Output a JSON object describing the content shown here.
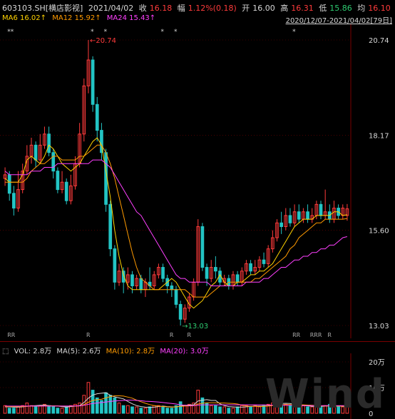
{
  "header": {
    "code": "603103.SH[横店影视]",
    "date": "2021/04/02",
    "close_label": "收",
    "close_value": "16.18",
    "change_label": "幅",
    "change_value": "1.12%(0.18)",
    "open_label": "开",
    "open_value": "16.00",
    "high_label": "高",
    "high_value": "16.31",
    "low_label": "低",
    "low_value": "15.86",
    "avg_label": "均",
    "avg_value": "16.10",
    "ma6": "MA6 16.02↑",
    "ma12": "MA12 15.92↑",
    "ma24": "MA24 15.43↑",
    "range": "2020/12/07-2021/04/02[79日]"
  },
  "volume_header": {
    "vol": "VOL: 2.8万",
    "ma5": "MA(5): 2.6万",
    "ma10": "MA(10): 2.8万",
    "ma20": "MA(20): 3.0万"
  },
  "colors": {
    "up": "#ff3b3b",
    "down": "#23c4c4",
    "ma6": "#ffd200",
    "ma12": "#ff9a00",
    "ma24": "#ff40ff",
    "grid": "#7a0000"
  },
  "annotations": {
    "high": "20.74",
    "low": "13.03",
    "watermark": "Wind"
  },
  "chart_data": {
    "type": "candlestick",
    "price_ticks": [
      "20.74",
      "18.17",
      "15.60",
      "13.03"
    ],
    "price_range": [
      13.03,
      20.74
    ],
    "volume_ticks": [
      "20万",
      "10万",
      "0"
    ],
    "volume_range": [
      0,
      20
    ],
    "markers_top": [
      "**",
      "*",
      "*",
      "*",
      "*",
      "*"
    ],
    "markers_bottom": [
      "RR",
      "R",
      "R",
      "R",
      "RR",
      "RRR",
      "R"
    ],
    "series": [
      {
        "name": "MA6",
        "values": [
          17.0,
          16.9,
          16.9,
          16.9,
          17.1,
          17.5,
          17.6,
          17.5,
          17.4,
          17.6,
          17.9,
          17.8,
          17.6,
          17.4,
          17.3,
          17.2,
          17.3,
          17.4,
          17.6,
          17.8,
          18.0,
          18.1,
          17.9,
          17.2,
          16.5,
          15.6,
          14.9,
          14.4,
          14.1,
          14.0,
          14.0,
          14.0,
          14.0,
          14.0,
          14.0,
          14.0,
          14.1,
          14.2,
          14.3,
          14.2,
          14.0,
          13.8,
          13.6,
          13.5,
          13.6,
          13.7,
          13.9,
          14.1,
          14.2,
          14.4,
          14.2,
          14.1,
          14.1,
          14.2,
          14.2,
          14.3,
          14.4,
          14.4,
          14.5,
          14.5,
          14.6,
          14.7,
          14.9,
          15.1,
          15.3,
          15.5,
          15.7,
          15.8,
          15.9,
          15.9,
          15.9,
          16.0,
          16.0,
          16.0,
          16.0,
          16.1,
          16.1,
          16.0,
          16.02
        ]
      },
      {
        "name": "MA12",
        "values": [
          16.9,
          16.9,
          16.9,
          16.9,
          16.9,
          17.0,
          17.2,
          17.3,
          17.4,
          17.4,
          17.5,
          17.6,
          17.6,
          17.5,
          17.5,
          17.5,
          17.5,
          17.6,
          17.6,
          17.7,
          17.8,
          17.9,
          17.9,
          17.7,
          17.4,
          17.0,
          16.5,
          16.0,
          15.5,
          15.0,
          14.6,
          14.3,
          14.2,
          14.1,
          14.0,
          14.0,
          14.0,
          14.0,
          14.0,
          14.0,
          14.0,
          14.0,
          13.9,
          13.8,
          13.8,
          13.8,
          13.8,
          13.9,
          14.0,
          14.1,
          14.1,
          14.2,
          14.2,
          14.2,
          14.2,
          14.2,
          14.2,
          14.3,
          14.3,
          14.4,
          14.5,
          14.6,
          14.7,
          14.8,
          14.9,
          15.1,
          15.2,
          15.4,
          15.5,
          15.6,
          15.7,
          15.8,
          15.8,
          15.9,
          15.9,
          15.9,
          15.9,
          15.9,
          15.92
        ]
      },
      {
        "name": "MA24",
        "values": [
          17.2,
          17.1,
          17.1,
          17.1,
          17.1,
          17.1,
          17.2,
          17.2,
          17.2,
          17.3,
          17.3,
          17.3,
          17.4,
          17.4,
          17.4,
          17.4,
          17.4,
          17.4,
          17.4,
          17.4,
          17.5,
          17.5,
          17.5,
          17.4,
          17.3,
          17.1,
          16.9,
          16.7,
          16.5,
          16.3,
          16.1,
          16.0,
          15.8,
          15.6,
          15.4,
          15.2,
          15.0,
          14.8,
          14.6,
          14.4,
          14.3,
          14.3,
          14.2,
          14.2,
          14.2,
          14.2,
          14.2,
          14.1,
          14.1,
          14.1,
          14.1,
          14.1,
          14.1,
          14.1,
          14.1,
          14.2,
          14.2,
          14.2,
          14.2,
          14.3,
          14.3,
          14.4,
          14.5,
          14.6,
          14.6,
          14.7,
          14.8,
          14.8,
          14.9,
          14.9,
          15.0,
          15.0,
          15.1,
          15.1,
          15.2,
          15.2,
          15.3,
          15.4,
          15.43
        ]
      }
    ],
    "candles": [
      [
        17.0,
        17.1,
        16.8,
        17.3
      ],
      [
        17.1,
        16.6,
        16.4,
        17.2
      ],
      [
        16.6,
        16.2,
        16.0,
        16.8
      ],
      [
        16.2,
        16.7,
        16.1,
        17.2
      ],
      [
        16.7,
        17.2,
        16.6,
        17.4
      ],
      [
        17.2,
        17.6,
        17.1,
        17.9
      ],
      [
        17.6,
        17.9,
        17.4,
        18.1
      ],
      [
        17.9,
        17.5,
        17.3,
        18.0
      ],
      [
        17.5,
        17.9,
        17.4,
        18.2
      ],
      [
        17.9,
        18.2,
        17.8,
        18.4
      ],
      [
        18.2,
        17.7,
        17.6,
        18.4
      ],
      [
        17.7,
        17.2,
        17.0,
        17.8
      ],
      [
        17.2,
        16.7,
        16.6,
        17.3
      ],
      [
        16.7,
        16.9,
        16.6,
        17.2
      ],
      [
        16.9,
        16.4,
        16.3,
        17.0
      ],
      [
        16.4,
        16.8,
        16.3,
        17.1
      ],
      [
        16.8,
        17.4,
        16.7,
        17.6
      ],
      [
        17.4,
        18.2,
        17.3,
        18.5
      ],
      [
        18.2,
        19.5,
        18.0,
        19.7
      ],
      [
        19.5,
        20.2,
        19.3,
        20.74
      ],
      [
        20.2,
        19.0,
        18.8,
        20.3
      ],
      [
        19.0,
        18.3,
        18.0,
        19.2
      ],
      [
        18.3,
        17.7,
        17.5,
        18.5
      ],
      [
        17.7,
        16.3,
        16.1,
        17.8
      ],
      [
        16.3,
        15.1,
        14.9,
        16.4
      ],
      [
        15.1,
        14.2,
        14.0,
        15.2
      ],
      [
        14.2,
        14.5,
        14.1,
        14.7
      ],
      [
        14.5,
        14.2,
        13.9,
        14.6
      ],
      [
        14.2,
        14.4,
        14.0,
        14.6
      ],
      [
        14.4,
        14.1,
        13.9,
        14.5
      ],
      [
        14.1,
        14.3,
        14.0,
        14.4
      ],
      [
        14.3,
        14.0,
        13.9,
        14.4
      ],
      [
        14.0,
        14.2,
        13.8,
        14.3
      ],
      [
        14.2,
        14.1,
        14.0,
        14.6
      ],
      [
        14.1,
        14.4,
        14.0,
        14.5
      ],
      [
        14.4,
        14.6,
        14.3,
        14.7
      ],
      [
        14.6,
        14.3,
        14.2,
        14.7
      ],
      [
        14.3,
        14.1,
        13.9,
        14.4
      ],
      [
        14.1,
        14.0,
        13.8,
        14.2
      ],
      [
        14.0,
        13.6,
        13.5,
        14.1
      ],
      [
        13.6,
        13.2,
        13.03,
        13.7
      ],
      [
        13.2,
        13.5,
        13.1,
        13.6
      ],
      [
        13.5,
        13.8,
        13.4,
        13.9
      ],
      [
        13.8,
        14.2,
        13.7,
        14.3
      ],
      [
        14.2,
        15.7,
        14.1,
        15.9
      ],
      [
        15.7,
        14.6,
        14.5,
        15.8
      ],
      [
        14.6,
        14.3,
        14.1,
        14.7
      ],
      [
        14.3,
        14.6,
        14.2,
        14.8
      ],
      [
        14.6,
        14.5,
        14.3,
        14.9
      ],
      [
        14.5,
        14.2,
        14.1,
        14.6
      ],
      [
        14.2,
        14.3,
        14.1,
        14.4
      ],
      [
        14.3,
        14.1,
        14.0,
        14.4
      ],
      [
        14.1,
        14.4,
        14.0,
        14.5
      ],
      [
        14.4,
        14.2,
        14.1,
        14.5
      ],
      [
        14.2,
        14.5,
        14.1,
        14.6
      ],
      [
        14.5,
        14.7,
        14.4,
        14.8
      ],
      [
        14.7,
        14.5,
        14.4,
        14.8
      ],
      [
        14.5,
        14.6,
        14.4,
        14.8
      ],
      [
        14.6,
        14.8,
        14.5,
        14.9
      ],
      [
        14.8,
        14.7,
        14.6,
        15.0
      ],
      [
        14.7,
        15.1,
        14.6,
        15.2
      ],
      [
        15.1,
        15.4,
        15.0,
        15.6
      ],
      [
        15.4,
        15.8,
        15.3,
        15.9
      ],
      [
        15.8,
        15.7,
        15.5,
        16.1
      ],
      [
        15.7,
        16.0,
        15.6,
        16.2
      ],
      [
        16.0,
        15.8,
        15.7,
        16.2
      ],
      [
        15.8,
        16.1,
        15.7,
        16.3
      ],
      [
        16.1,
        15.9,
        15.8,
        16.3
      ],
      [
        15.9,
        16.1,
        15.8,
        16.2
      ],
      [
        16.1,
        15.9,
        15.8,
        16.3
      ],
      [
        15.9,
        16.0,
        15.8,
        16.2
      ],
      [
        16.0,
        16.3,
        15.9,
        16.4
      ],
      [
        16.3,
        16.0,
        15.9,
        16.4
      ],
      [
        16.0,
        16.1,
        15.9,
        16.7
      ],
      [
        16.1,
        15.9,
        15.8,
        16.3
      ],
      [
        15.9,
        16.2,
        15.8,
        16.4
      ],
      [
        16.2,
        16.0,
        15.9,
        16.3
      ],
      [
        16.0,
        16.2,
        15.9,
        16.3
      ],
      [
        16.0,
        16.18,
        15.86,
        16.31
      ]
    ],
    "volume": [
      3,
      2,
      2,
      2.5,
      3,
      4,
      3,
      2.5,
      3,
      3.5,
      3,
      2.5,
      2,
      2,
      2.5,
      3,
      3.5,
      4,
      7,
      12,
      9,
      6,
      5,
      8,
      7,
      6,
      4,
      3,
      3,
      2.5,
      2.5,
      2,
      2,
      2.5,
      3,
      3,
      2.5,
      2,
      2,
      3,
      4.5,
      3,
      3.5,
      4,
      9,
      6,
      4,
      3,
      3,
      2.5,
      2.5,
      2,
      2,
      2.5,
      3,
      3,
      2.5,
      3,
      2.5,
      3,
      3.5,
      4,
      4.5,
      4,
      3.5,
      3,
      3,
      2.5,
      3,
      2.5,
      2.5,
      3,
      2.5,
      3,
      3.5,
      2.5,
      2.5,
      2.5,
      2.8
    ],
    "volume_ma": [
      {
        "name": "MA(5)",
        "values": [
          2.5,
          2.5,
          2.4,
          2.4,
          2.5,
          2.7,
          2.9,
          3.0,
          3.1,
          3.2,
          3.0,
          2.9,
          2.8,
          2.6,
          2.4,
          2.6,
          2.8,
          3.0,
          4.2,
          5.9,
          7.1,
          7.6,
          7.8,
          8.0,
          7.0,
          6.4,
          6.0,
          5.6,
          4.6,
          3.7,
          3.0,
          2.6,
          2.4,
          2.3,
          2.4,
          2.6,
          2.8,
          2.6,
          2.5,
          2.5,
          2.8,
          3.1,
          3.2,
          3.3,
          4.8,
          5.1,
          5.3,
          5.0,
          5.0,
          3.7,
          3.0,
          2.6,
          2.5,
          2.4,
          2.4,
          2.5,
          2.7,
          2.8,
          2.8,
          2.8,
          2.9,
          3.2,
          3.5,
          3.8,
          3.9,
          3.8,
          3.6,
          3.2,
          3.0,
          2.9,
          2.7,
          2.7,
          2.7,
          2.8,
          2.9,
          2.8,
          2.8,
          2.7,
          2.6
        ]
      },
      {
        "name": "MA(10)",
        "values": [
          2.6,
          2.6,
          2.6,
          2.6,
          2.6,
          2.7,
          2.8,
          2.8,
          2.8,
          2.9,
          2.9,
          2.9,
          2.9,
          2.8,
          2.8,
          2.8,
          2.8,
          2.9,
          3.4,
          4.3,
          5.0,
          5.3,
          5.5,
          6.0,
          6.5,
          6.8,
          6.8,
          6.7,
          6.3,
          5.9,
          5.1,
          4.5,
          3.9,
          3.4,
          3.0,
          2.8,
          2.6,
          2.5,
          2.4,
          2.5,
          2.7,
          2.8,
          2.9,
          3.0,
          3.6,
          3.9,
          4.1,
          4.1,
          4.1,
          4.0,
          4.0,
          3.9,
          3.8,
          3.6,
          3.2,
          2.8,
          2.7,
          2.7,
          2.6,
          2.7,
          2.8,
          3.0,
          3.2,
          3.3,
          3.4,
          3.4,
          3.4,
          3.3,
          3.3,
          3.2,
          3.1,
          3.0,
          2.9,
          2.9,
          2.9,
          2.8,
          2.8,
          2.8,
          2.8
        ]
      },
      {
        "name": "MA(20)",
        "values": [
          2.8,
          2.8,
          2.8,
          2.8,
          2.8,
          2.8,
          2.8,
          2.8,
          2.8,
          2.8,
          2.8,
          2.8,
          2.8,
          2.8,
          2.8,
          2.8,
          2.9,
          2.9,
          3.1,
          3.5,
          3.8,
          4.0,
          4.2,
          4.4,
          4.6,
          4.8,
          4.9,
          5.0,
          5.1,
          5.1,
          5.0,
          4.9,
          4.7,
          4.6,
          4.5,
          4.4,
          4.2,
          4.0,
          3.8,
          3.6,
          3.3,
          3.1,
          3.0,
          3.0,
          3.2,
          3.3,
          3.3,
          3.3,
          3.3,
          3.3,
          3.3,
          3.3,
          3.3,
          3.3,
          3.3,
          3.3,
          3.3,
          3.3,
          3.3,
          3.3,
          3.2,
          3.2,
          3.2,
          3.2,
          3.1,
          3.1,
          3.1,
          3.0,
          3.0,
          3.0,
          3.0,
          3.0,
          3.0,
          3.0,
          3.0,
          3.0,
          3.0,
          3.0,
          3.0
        ]
      }
    ]
  }
}
